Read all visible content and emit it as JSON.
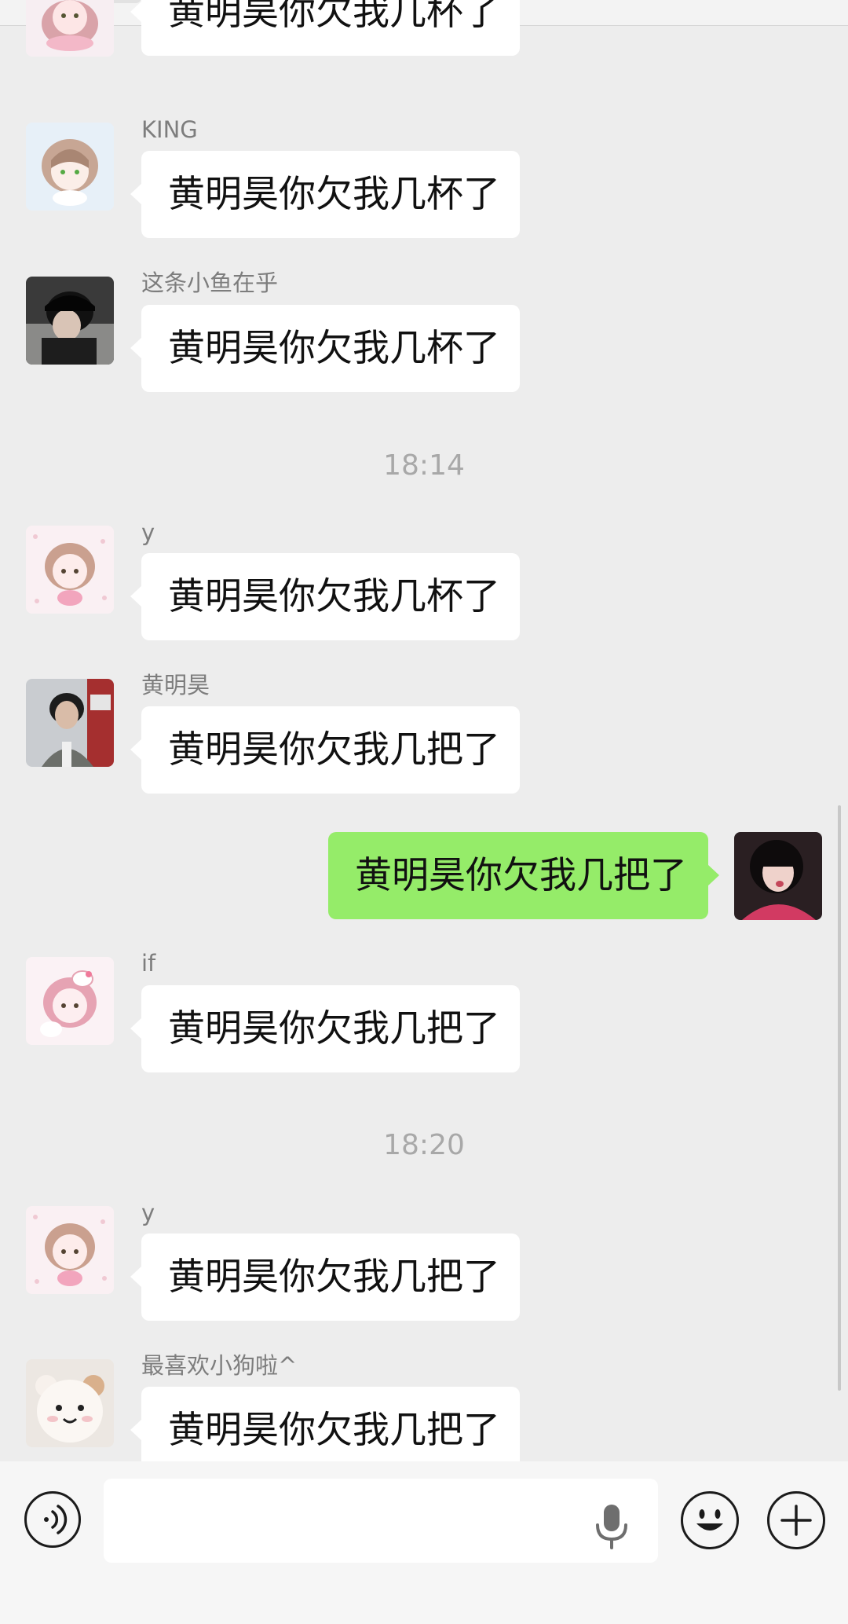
{
  "chat": {
    "messages": [
      {
        "type": "in",
        "sender": "",
        "text": "黄明昊你欠我几杯了",
        "avatar": "avatar-girl-pink-bow-icon"
      },
      {
        "type": "in",
        "sender": "KING",
        "text": "黄明昊你欠我几杯了",
        "avatar": "avatar-girl-brown-hair-icon"
      },
      {
        "type": "in",
        "sender": "这条小鱼在乎",
        "text": "黄明昊你欠我几杯了",
        "avatar": "avatar-girl-black-cap-photo-icon"
      },
      {
        "type": "time",
        "text": "18:14"
      },
      {
        "type": "in",
        "sender": "y",
        "text": "黄明昊你欠我几杯了",
        "avatar": "avatar-girl-pink-dots-icon"
      },
      {
        "type": "in",
        "sender": "黄明昊",
        "text": "黄明昊你欠我几把了",
        "avatar": "avatar-boy-photo-icon"
      },
      {
        "type": "out",
        "text": "黄明昊你欠我几把了",
        "avatar": "avatar-self-photo-icon"
      },
      {
        "type": "in",
        "sender": "if",
        "text": "黄明昊你欠我几把了",
        "avatar": "avatar-girl-hello-kitty-icon"
      },
      {
        "type": "time",
        "text": "18:20"
      },
      {
        "type": "in",
        "sender": "y",
        "text": "黄明昊你欠我几把了",
        "avatar": "avatar-girl-pink-dots-icon"
      },
      {
        "type": "in",
        "sender": "最喜欢小狗啦^",
        "text": "黄明昊你欠我几把了",
        "avatar": "avatar-plush-bear-icon"
      }
    ]
  },
  "input_bar": {
    "text_value": "",
    "icons": [
      "voice-icon",
      "microphone-icon",
      "emoji-icon",
      "plus-icon"
    ]
  },
  "colors": {
    "background": "#ededed",
    "bubble_in": "#ffffff",
    "bubble_out": "#95ec69",
    "sender_text": "#7d7d7d",
    "time_text": "#a8a8a8"
  }
}
